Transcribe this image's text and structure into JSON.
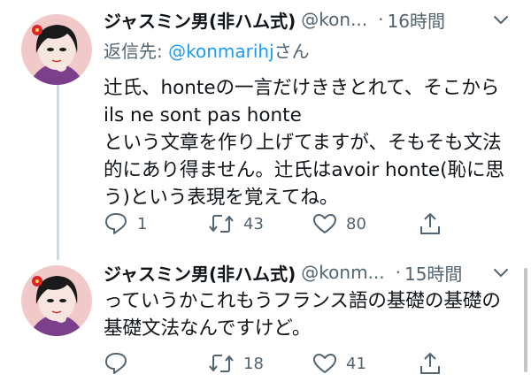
{
  "tweets": [
    {
      "display_name": "ジャスミン男(非ハム式)",
      "handle": "@kon...",
      "time": "16時間",
      "reply_prefix": "返信先: ",
      "reply_mention": "@konmarihj",
      "reply_suffix": "さん",
      "text_lines": [
        "辻氏、honteの一言だけききとれて、そこから",
        "ils ne sont pas honte",
        "という文章を作り上げてますが、そもそも文法",
        "的にあり得ません。辻氏はavoir honte(恥に思",
        "う)という表現を覚えてね。"
      ],
      "actions": {
        "reply": "1",
        "retweet": "43",
        "like": "80"
      }
    },
    {
      "display_name": "ジャスミン男(非ハム式)",
      "handle": "@konm...",
      "time": "15時間",
      "text_lines": [
        "っていうかこれもうフランス語の基礎の基礎の",
        "基礎文法なんですけど。"
      ],
      "actions": {
        "reply": "",
        "retweet": "18",
        "like": "41"
      }
    }
  ],
  "icons": [
    "avatar",
    "more-caret-icon",
    "reply-icon",
    "retweet-icon",
    "like-icon",
    "share-icon"
  ],
  "colors": {
    "text": "#0f1419",
    "secondary": "#536471",
    "link": "#1d9bf0",
    "thread_line": "#cfd9de"
  }
}
